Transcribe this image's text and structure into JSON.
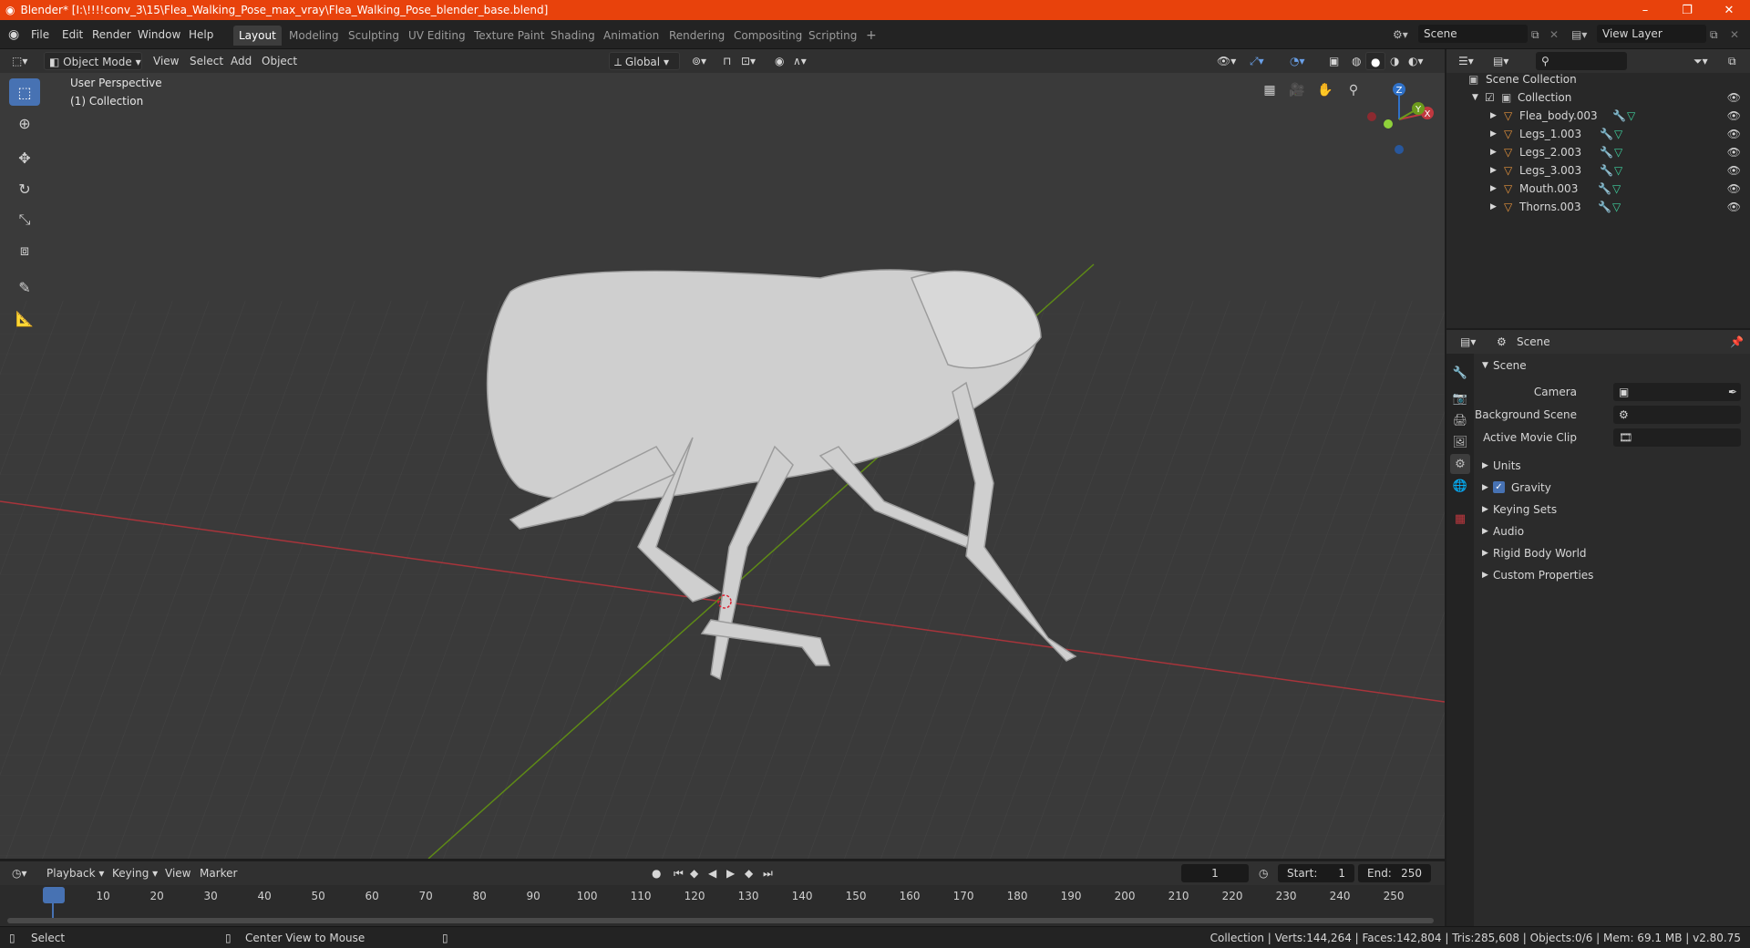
{
  "window": {
    "title": "Blender* [I:\\!!!!conv_3\\15\\Flea_Walking_Pose_max_vray\\Flea_Walking_Pose_blender_base.blend]",
    "controls": [
      "–",
      "❐",
      "✕"
    ]
  },
  "menu": {
    "items": [
      "File",
      "Edit",
      "Render",
      "Window",
      "Help"
    ],
    "workspaces": [
      "Layout",
      "Modeling",
      "Sculpting",
      "UV Editing",
      "Texture Paint",
      "Shading",
      "Animation",
      "Rendering",
      "Compositing",
      "Scripting"
    ],
    "active_workspace": "Layout",
    "add_workspace": "+",
    "scene": "Scene",
    "view_layer": "View Layer"
  },
  "viewport_header": {
    "mode": "Object Mode",
    "menus": [
      "View",
      "Select",
      "Add",
      "Object"
    ],
    "orientation": "Global"
  },
  "viewport": {
    "perspective_label": "User Perspective",
    "collection_label": "(1) Collection",
    "gizmo": {
      "x": "X",
      "y": "Y",
      "z": "Z"
    }
  },
  "outliner": {
    "root": "Scene Collection",
    "collection": "Collection",
    "objects": [
      "Flea_body.003",
      "Legs_1.003",
      "Legs_2.003",
      "Legs_3.003",
      "Mouth.003",
      "Thorns.003"
    ]
  },
  "properties": {
    "header": "Scene",
    "panel_title": "Scene",
    "fields": [
      {
        "label": "Camera",
        "value": ""
      },
      {
        "label": "Background Scene",
        "value": ""
      },
      {
        "label": "Active Movie Clip",
        "value": ""
      }
    ],
    "sections": [
      "Units",
      "Gravity",
      "Keying Sets",
      "Audio",
      "Rigid Body World",
      "Custom Properties"
    ],
    "gravity_checked": true
  },
  "timeline": {
    "menus": [
      "Playback",
      "Keying",
      "View",
      "Marker"
    ],
    "current_frame": "1",
    "start_label": "Start:",
    "start": "1",
    "end_label": "End:",
    "end": "250",
    "ticks": [
      "1",
      "10",
      "20",
      "30",
      "40",
      "50",
      "60",
      "70",
      "80",
      "90",
      "100",
      "110",
      "120",
      "130",
      "140",
      "150",
      "160",
      "170",
      "180",
      "190",
      "200",
      "210",
      "220",
      "230",
      "240",
      "250"
    ]
  },
  "statusbar": {
    "select": "Select",
    "center_view": "Center View to Mouse",
    "stats": "Collection | Verts:144,264 | Faces:142,804 | Tris:285,608 | Objects:0/6 | Mem: 69.1 MB | v2.80.75"
  },
  "colors": {
    "titlebar": "#e8420c",
    "accent": "#4772b3",
    "x_axis": "#c0383f",
    "y_axis": "#6c9a1c",
    "z_axis": "#2f71c8",
    "mesh_icon": "#e5933c",
    "modifier_icon": "#5a9de0",
    "data_icon": "#3fd29f"
  }
}
